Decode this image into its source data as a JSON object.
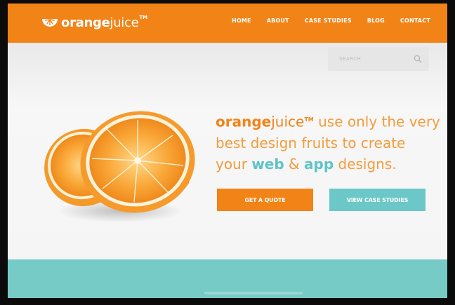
{
  "brand": {
    "bold": "orange",
    "light": "juice",
    "tm": "TM"
  },
  "nav": [
    {
      "label": "HOME"
    },
    {
      "label": "ABOUT"
    },
    {
      "label": "CASE STUDIES"
    },
    {
      "label": "BLOG"
    },
    {
      "label": "CONTACT"
    }
  ],
  "search": {
    "placeholder": "SEARCH",
    "icon": "search-icon"
  },
  "hero": {
    "brand_bold": "orange",
    "brand_light": "juice",
    "brand_tm": "TM",
    "text_1": " use only the very best design fruits to create your ",
    "web": "web",
    "amp": " & ",
    "app": "app",
    "text_2": " designs."
  },
  "buttons": {
    "quote": "GET A QUOTE",
    "cases": "VIEW CASE STUDIES"
  },
  "colors": {
    "orange": "#f28317",
    "teal": "#76cbc7",
    "background": "#f2f2f2"
  }
}
